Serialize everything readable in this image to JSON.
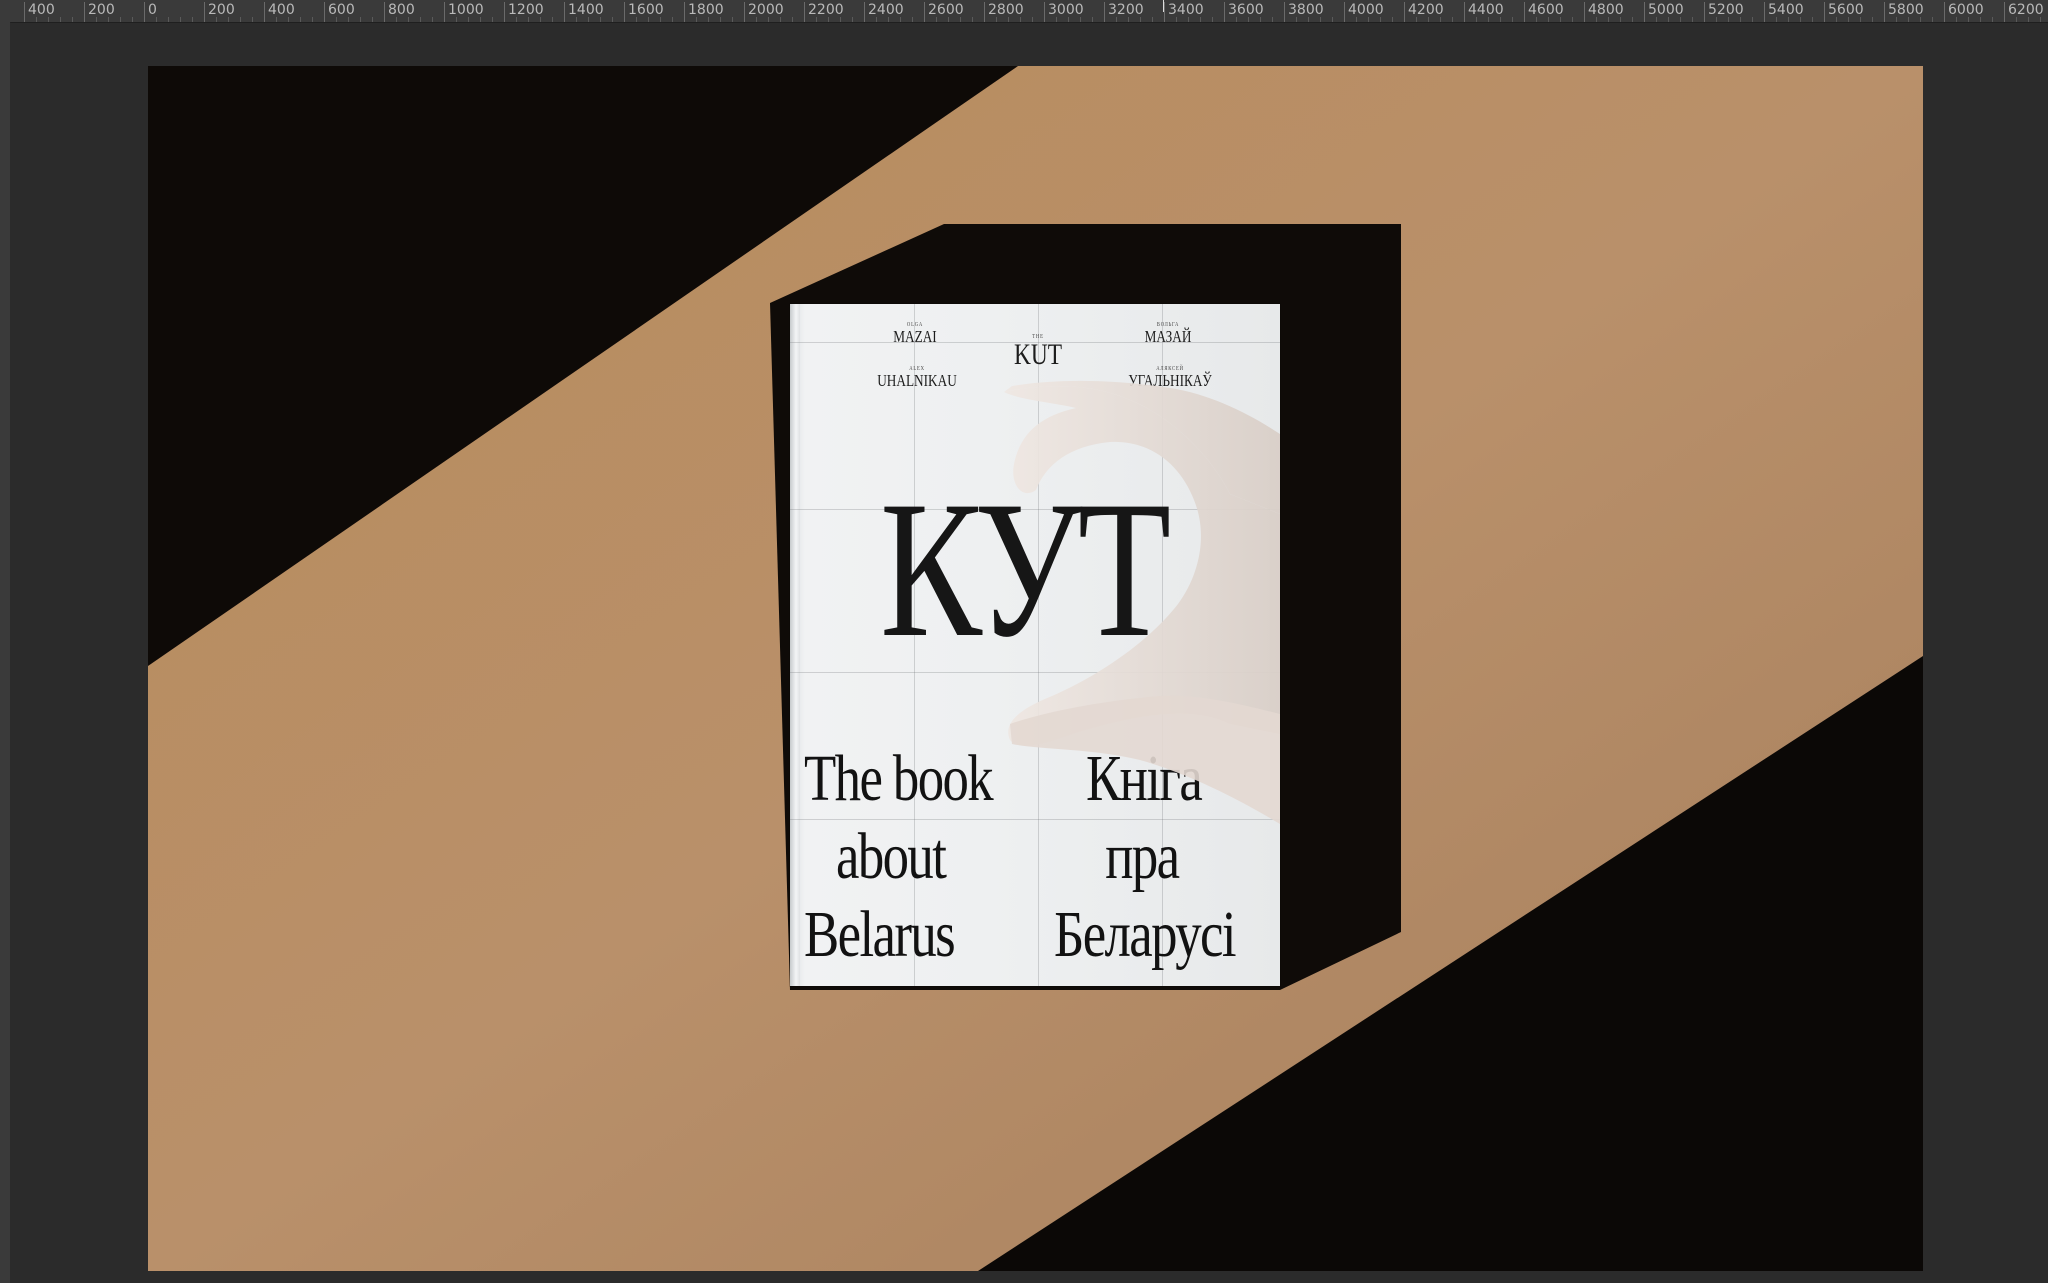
{
  "ruler": {
    "labels": [
      "400",
      "200",
      "0",
      "200",
      "400",
      "600",
      "800",
      "1000",
      "1200",
      "1400",
      "1600",
      "1800",
      "2000",
      "2200",
      "2400",
      "2600",
      "2800",
      "3000",
      "3200",
      "3400",
      "3600",
      "3800",
      "4000",
      "4200",
      "4400",
      "4600",
      "4800",
      "5000",
      "5200",
      "5400",
      "5600",
      "5800",
      "6000",
      "6200"
    ]
  },
  "book": {
    "credits": {
      "en_author1_small": "OLGA",
      "en_author1": "MAZAI",
      "en_author2_small": "ALEX",
      "en_author2": "UHALNIKAU",
      "center_small": "THE",
      "center": "KUT",
      "be_author1_small": "ВОЛЬГА",
      "be_author1": "МАЗАЙ",
      "be_author2_small": "АЛЯКСЕЙ",
      "be_author2": "УГАЛЬНІКАЎ"
    },
    "title": "КУТ",
    "subtitle_en": [
      "The book",
      "about",
      "Belarus"
    ],
    "subtitle_be": [
      "Кніга",
      "пра",
      "Беларусі"
    ]
  },
  "colors": {
    "table": "#b48a5f",
    "shadow": "#0d0907",
    "cover": "#eef0f1"
  }
}
